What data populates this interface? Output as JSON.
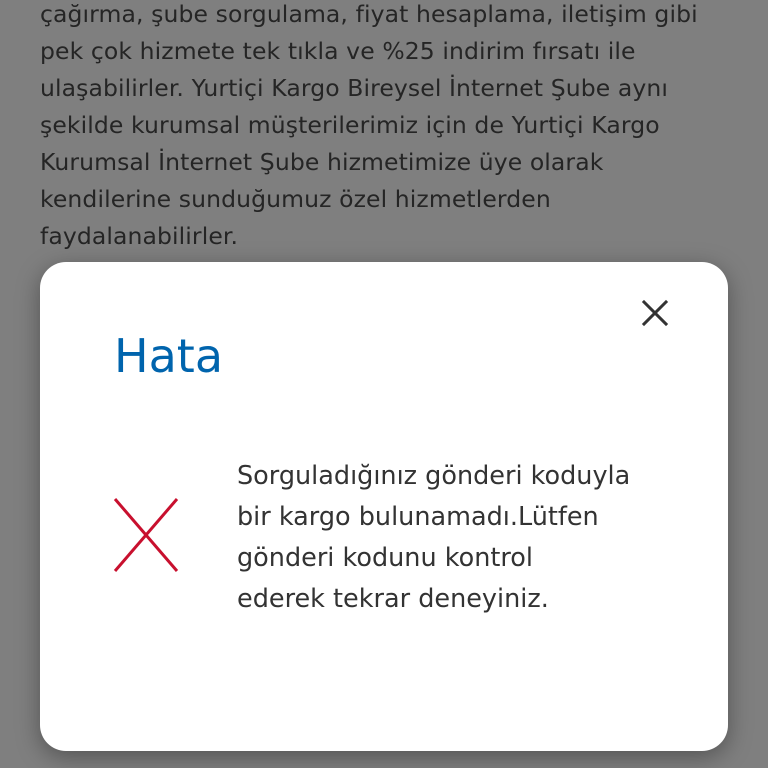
{
  "background_text": {
    "lines": [
      "çağırma, şube sorgulama, fiyat hesaplama, iletişim gibi",
      "pek çok hizmete tek tıkla ve %25 indirim fırsatı ile",
      "ulaşabilirler. Yurtiçi Kargo Bireysel İnternet Şube aynı",
      "şekilde kurumsal müşterilerimiz için de Yurtiçi Kargo",
      "Kurumsal İnternet Şube hizmetimize üye olarak",
      "kendilerine sunduğumuz özel hizmetlerden",
      "faydalanabilirler."
    ]
  },
  "modal": {
    "title": "Hata",
    "close_icon": "close-icon",
    "error_icon": "error-x-icon",
    "message_lines": [
      "Sorguladığınız gönderi koduyla",
      "bir kargo bulunamadı.Lütfen",
      "gönderi kodunu kontrol",
      "ederek tekrar deneyiniz."
    ]
  },
  "colors": {
    "title": "#0064ad",
    "error_icon": "#c8102e",
    "overlay": "rgba(0,0,0,0.5)"
  }
}
